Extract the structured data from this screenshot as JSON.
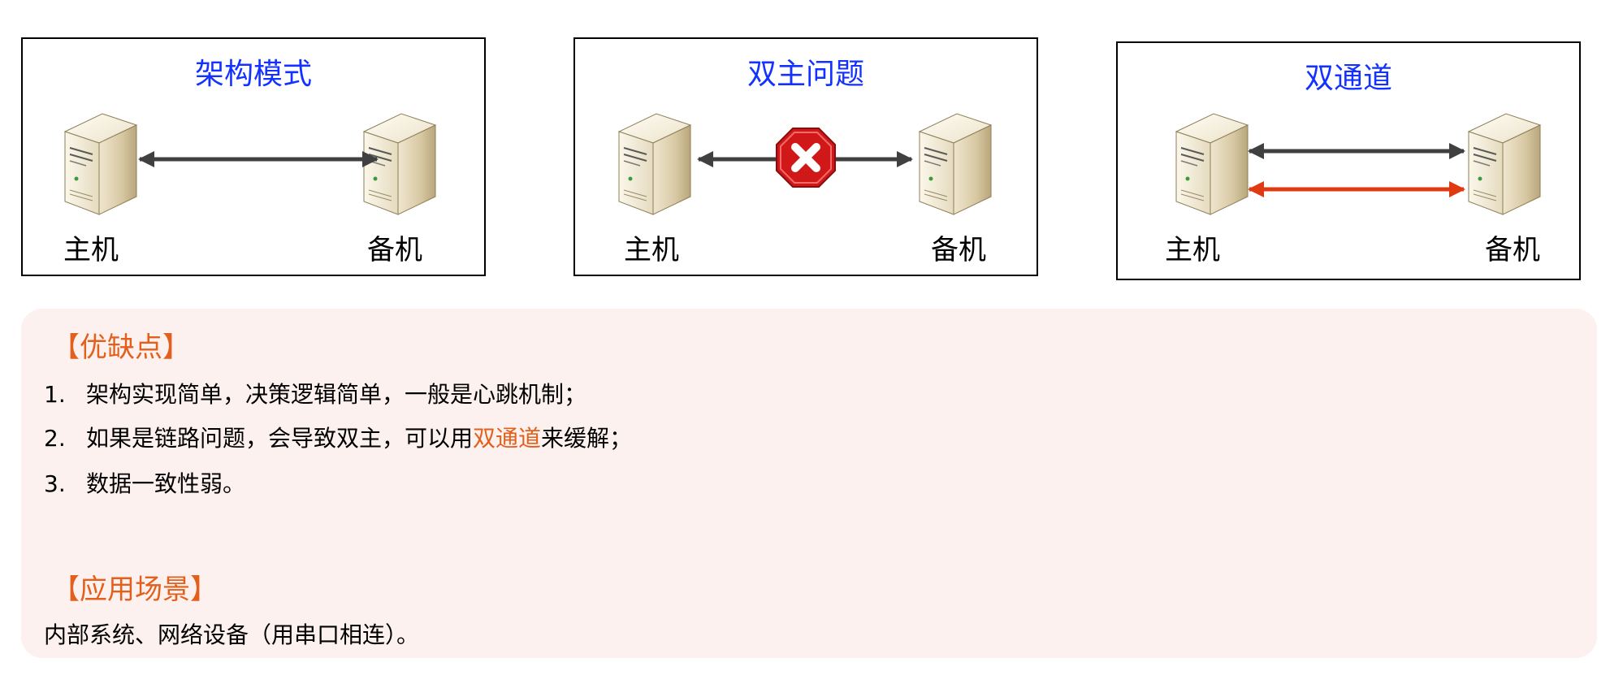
{
  "panels": [
    {
      "title": "架构模式",
      "primary": "主机",
      "backup": "备机"
    },
    {
      "title": "双主问题",
      "primary": "主机",
      "backup": "备机"
    },
    {
      "title": "双通道",
      "primary": "主机",
      "backup": "备机"
    }
  ],
  "notes": {
    "pros_title": "【优缺点】",
    "items": [
      {
        "num": "1.",
        "text": "架构实现简单，决策逻辑简单，一般是心跳机制；"
      },
      {
        "num": "2.",
        "before": "如果是链路问题，会导致双主，可以用",
        "highlight": "双通道",
        "after": "来缓解；"
      },
      {
        "num": "3.",
        "text": "数据一致性弱。"
      }
    ],
    "scenario_title": "【应用场景】",
    "scenario_text": "内部系统、网络设备（用串口相连）。"
  },
  "colors": {
    "title_blue": "#1432ff",
    "accent_orange": "#e2601c",
    "link_dark": "#404040",
    "link_red": "#e03a12",
    "notes_bg": "#fcf1ee"
  },
  "icons": [
    "server-icon",
    "error-stop-icon",
    "double-arrow-icon"
  ]
}
